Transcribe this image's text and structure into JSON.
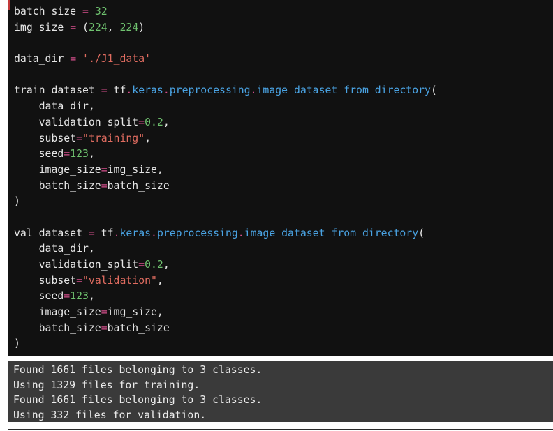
{
  "colors": {
    "cell_background": "#111111",
    "output_background": "#3a3a3a",
    "default": "#e6e6e6",
    "operator": "#d64f8d",
    "number": "#6fc26f",
    "string": "#e06c60",
    "attribute": "#4aa3e3"
  },
  "code_lines": [
    [
      [
        "batch_size ",
        "default"
      ],
      [
        "=",
        "op"
      ],
      [
        " ",
        "default"
      ],
      [
        "32",
        "num"
      ]
    ],
    [
      [
        "img_size ",
        "default"
      ],
      [
        "=",
        "op"
      ],
      [
        " (",
        "default"
      ],
      [
        "224",
        "num"
      ],
      [
        ", ",
        "default"
      ],
      [
        "224",
        "num"
      ],
      [
        ")",
        "default"
      ]
    ],
    [],
    [
      [
        "data_dir ",
        "default"
      ],
      [
        "=",
        "op"
      ],
      [
        " ",
        "default"
      ],
      [
        "'./J1_data'",
        "str"
      ]
    ],
    [],
    [
      [
        "train_dataset ",
        "default"
      ],
      [
        "=",
        "op"
      ],
      [
        " tf",
        "default"
      ],
      [
        ".",
        "op"
      ],
      [
        "keras",
        "attr"
      ],
      [
        ".",
        "op"
      ],
      [
        "preprocessing",
        "attr"
      ],
      [
        ".",
        "op"
      ],
      [
        "image_dataset_from_directory",
        "attr"
      ],
      [
        "(",
        "default"
      ]
    ],
    [
      [
        "    data_dir,",
        "default"
      ]
    ],
    [
      [
        "    validation_split",
        "default"
      ],
      [
        "=",
        "op"
      ],
      [
        "0.2",
        "num"
      ],
      [
        ",",
        "default"
      ]
    ],
    [
      [
        "    subset",
        "default"
      ],
      [
        "=",
        "op"
      ],
      [
        "\"training\"",
        "str"
      ],
      [
        ",",
        "default"
      ]
    ],
    [
      [
        "    seed",
        "default"
      ],
      [
        "=",
        "op"
      ],
      [
        "123",
        "num"
      ],
      [
        ",",
        "default"
      ]
    ],
    [
      [
        "    image_size",
        "default"
      ],
      [
        "=",
        "op"
      ],
      [
        "img_size,",
        "default"
      ]
    ],
    [
      [
        "    batch_size",
        "default"
      ],
      [
        "=",
        "op"
      ],
      [
        "batch_size",
        "default"
      ]
    ],
    [
      [
        ")",
        "default"
      ]
    ],
    [],
    [
      [
        "val_dataset ",
        "default"
      ],
      [
        "=",
        "op"
      ],
      [
        " tf",
        "default"
      ],
      [
        ".",
        "op"
      ],
      [
        "keras",
        "attr"
      ],
      [
        ".",
        "op"
      ],
      [
        "preprocessing",
        "attr"
      ],
      [
        ".",
        "op"
      ],
      [
        "image_dataset_from_directory",
        "attr"
      ],
      [
        "(",
        "default"
      ]
    ],
    [
      [
        "    data_dir,",
        "default"
      ]
    ],
    [
      [
        "    validation_split",
        "default"
      ],
      [
        "=",
        "op"
      ],
      [
        "0.2",
        "num"
      ],
      [
        ",",
        "default"
      ]
    ],
    [
      [
        "    subset",
        "default"
      ],
      [
        "=",
        "op"
      ],
      [
        "\"validation\"",
        "str"
      ],
      [
        ",",
        "default"
      ]
    ],
    [
      [
        "    seed",
        "default"
      ],
      [
        "=",
        "op"
      ],
      [
        "123",
        "num"
      ],
      [
        ",",
        "default"
      ]
    ],
    [
      [
        "    image_size",
        "default"
      ],
      [
        "=",
        "op"
      ],
      [
        "img_size,",
        "default"
      ]
    ],
    [
      [
        "    batch_size",
        "default"
      ],
      [
        "=",
        "op"
      ],
      [
        "batch_size",
        "default"
      ]
    ],
    [
      [
        ")",
        "default"
      ]
    ]
  ],
  "output_lines": [
    "Found 1661 files belonging to 3 classes.",
    "Using 1329 files for training.",
    "Found 1661 files belonging to 3 classes.",
    "Using 332 files for validation."
  ]
}
